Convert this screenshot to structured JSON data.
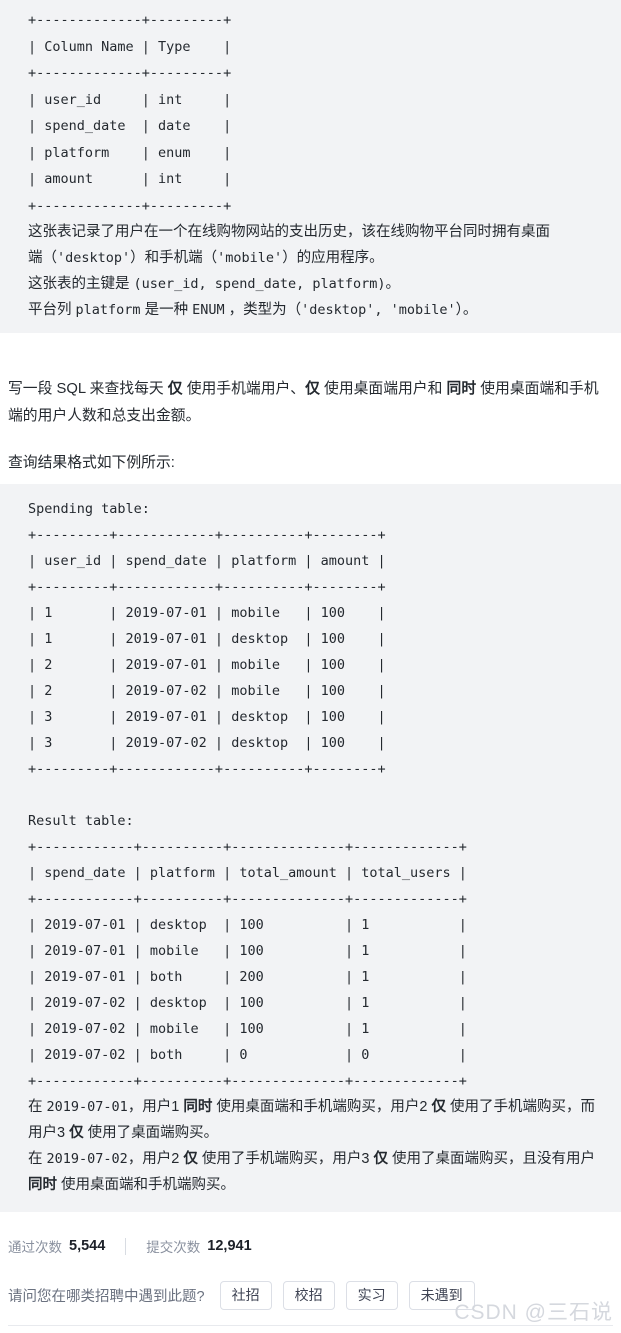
{
  "schema_block": {
    "name": "schema-code-block",
    "ascii_table": "+-------------+---------+\n| Column Name | Type    |\n+-------------+---------+\n| user_id     | int     |\n| spend_date  | date    |\n| platform    | enum    |\n| amount      | int     |\n+-------------+---------+",
    "desc_line1": "这张表记录了用户在一个在线购物网站的支出历史，该在线购物平台同时拥有桌面",
    "desc_line2_pre": "端（",
    "desc_line2_code1": "'desktop'",
    "desc_line2_mid": "）和手机端（",
    "desc_line2_code2": "'mobile'",
    "desc_line2_post": "）的应用程序。",
    "desc_line3_pre": "这张表的主键是 ",
    "desc_line3_code": "(user_id, spend_date, platform)",
    "desc_line3_post": "。",
    "desc_line4_pre": "平台列 ",
    "desc_line4_code1": "platform",
    "desc_line4_mid1": " 是一种 ",
    "desc_line4_code2": "ENUM",
    "desc_line4_mid2": " ，类型为（",
    "desc_line4_code3": "'desktop', 'mobile'",
    "desc_line4_post": "）。"
  },
  "prompt": {
    "line1_a": "写一段 SQL 来查找每天 ",
    "line1_b": "仅",
    "line1_c": " 使用手机端用户、",
    "line1_d": "仅",
    "line1_e": " 使用桌面端用户和 ",
    "line1_f": "同时",
    "line1_g": " 使用桌面端和手机端的用户人数和总支出金额。",
    "format_note": "查询结果格式如下例所示:"
  },
  "example_block": {
    "spending_title": "Spending table:",
    "spending_ascii": "+---------+------------+----------+--------+\n| user_id | spend_date | platform | amount |\n+---------+------------+----------+--------+\n| 1       | 2019-07-01 | mobile   | 100    |\n| 1       | 2019-07-01 | desktop  | 100    |\n| 2       | 2019-07-01 | mobile   | 100    |\n| 2       | 2019-07-02 | mobile   | 100    |\n| 3       | 2019-07-01 | desktop  | 100    |\n| 3       | 2019-07-02 | desktop  | 100    |\n+---------+------------+----------+--------+",
    "result_title": "Result table:",
    "result_ascii": "+------------+----------+--------------+-------------+\n| spend_date | platform | total_amount | total_users |\n+------------+----------+--------------+-------------+\n| 2019-07-01 | desktop  | 100          | 1           |\n| 2019-07-01 | mobile   | 100          | 1           |\n| 2019-07-01 | both     | 200          | 1           |\n| 2019-07-02 | desktop  | 100          | 1           |\n| 2019-07-02 | mobile   | 100          | 1           |\n| 2019-07-02 | both     | 0            | 0           |\n+------------+----------+--------------+-------------+",
    "expl1_a": "在 ",
    "expl1_date": "2019-07-01",
    "expl1_b": "，用户1 ",
    "expl1_bold1": "同时",
    "expl1_c": " 使用桌面端和手机端购买，用户2 ",
    "expl1_bold2": "仅",
    "expl1_d": " 使用了手机端购买，而用户3 ",
    "expl1_bold3": "仅",
    "expl1_e": " 使用了桌面端购买。",
    "expl2_a": "在 ",
    "expl2_date": "2019-07-02",
    "expl2_b": "，用户2 ",
    "expl2_bold1": "仅",
    "expl2_c": " 使用了手机端购买，用户3 ",
    "expl2_bold2": "仅",
    "expl2_d": " 使用了桌面端购买，且没有用户 ",
    "expl2_bold3": "同时",
    "expl2_e": " 使用桌面端和手机端购买。"
  },
  "stats": {
    "pass_label": "通过次数",
    "pass_value": "5,544",
    "submit_label": "提交次数",
    "submit_value": "12,941"
  },
  "poll": {
    "question": "请问您在哪类招聘中遇到此题?",
    "options": [
      {
        "label": "社招"
      },
      {
        "label": "校招"
      },
      {
        "label": "实习"
      },
      {
        "label": "未遇到"
      }
    ]
  },
  "watermark": {
    "text": "CSDN @三石说"
  },
  "colors": {
    "code_block_bg": "#f2f3f5",
    "page_bg": "#ffffff",
    "text": "#24292f",
    "muted_label": "#8a919f",
    "poll_question": "#6b7280",
    "button_border": "#dcdfe6",
    "watermark": "#d5d8de",
    "divider": "#e8eaee"
  }
}
